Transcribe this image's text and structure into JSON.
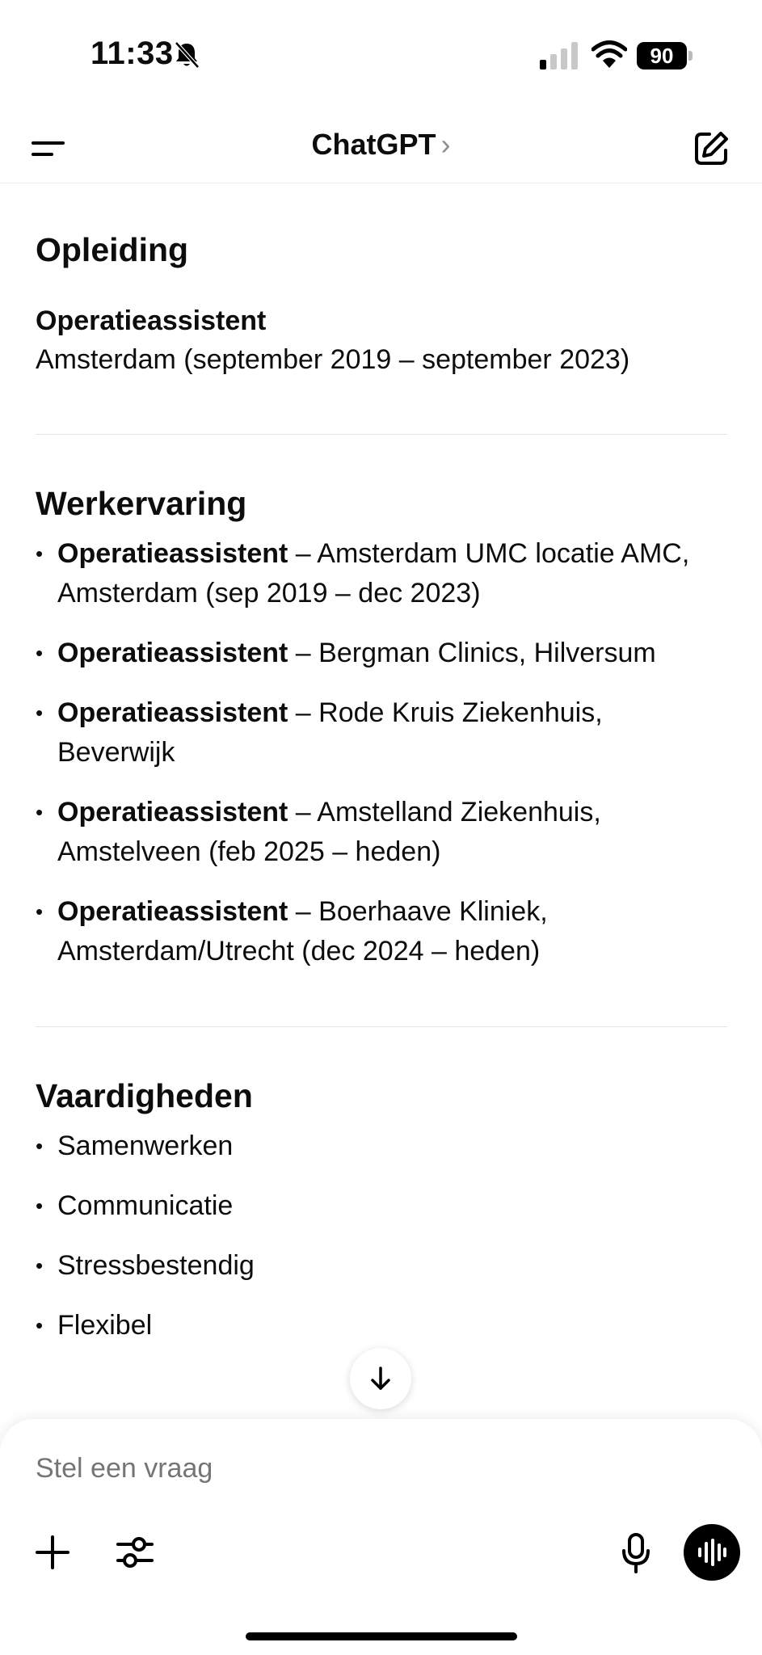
{
  "status_bar": {
    "time": "11:33",
    "battery": "90"
  },
  "header": {
    "title": "ChatGPT",
    "chevron": "›"
  },
  "sections": {
    "opleiding": {
      "heading": "Opleiding",
      "title": "Operatieassistent",
      "detail": "Amsterdam (september 2019 – september 2023)"
    },
    "werkervaring": {
      "heading": "Werkervaring",
      "items": [
        {
          "role": "Operatieassistent",
          "detail": " – Amsterdam UMC locatie AMC, Amsterdam (sep 2019 – dec 2023)"
        },
        {
          "role": "Operatieassistent",
          "detail": " – Bergman Clinics, Hilversum"
        },
        {
          "role": "Operatieassistent",
          "detail": " – Rode Kruis Ziekenhuis, Beverwijk"
        },
        {
          "role": "Operatieassistent",
          "detail": " – Amstelland Ziekenhuis, Amstelveen (feb 2025 – heden)"
        },
        {
          "role": "Operatieassistent",
          "detail": " – Boerhaave Kliniek, Amsterdam/Utrecht (dec 2024 – heden)"
        }
      ]
    },
    "vaardigheden": {
      "heading": "Vaardigheden",
      "items": [
        "Samenwerken",
        "Communicatie",
        "Stressbestendig",
        "Flexibel"
      ]
    }
  },
  "composer": {
    "placeholder": "Stel een vraag"
  },
  "icons": {
    "menu": "menu-icon",
    "compose": "compose-icon",
    "scroll": "arrow-down-icon",
    "plus": "plus-icon",
    "tools": "sliders-icon",
    "mic": "microphone-icon",
    "voice": "voice-waveform-icon"
  },
  "colors": {
    "text": "#0d0d0d",
    "placeholder": "#9b9b9b",
    "divider": "#e5e5e5",
    "voice_button": "#000000"
  }
}
